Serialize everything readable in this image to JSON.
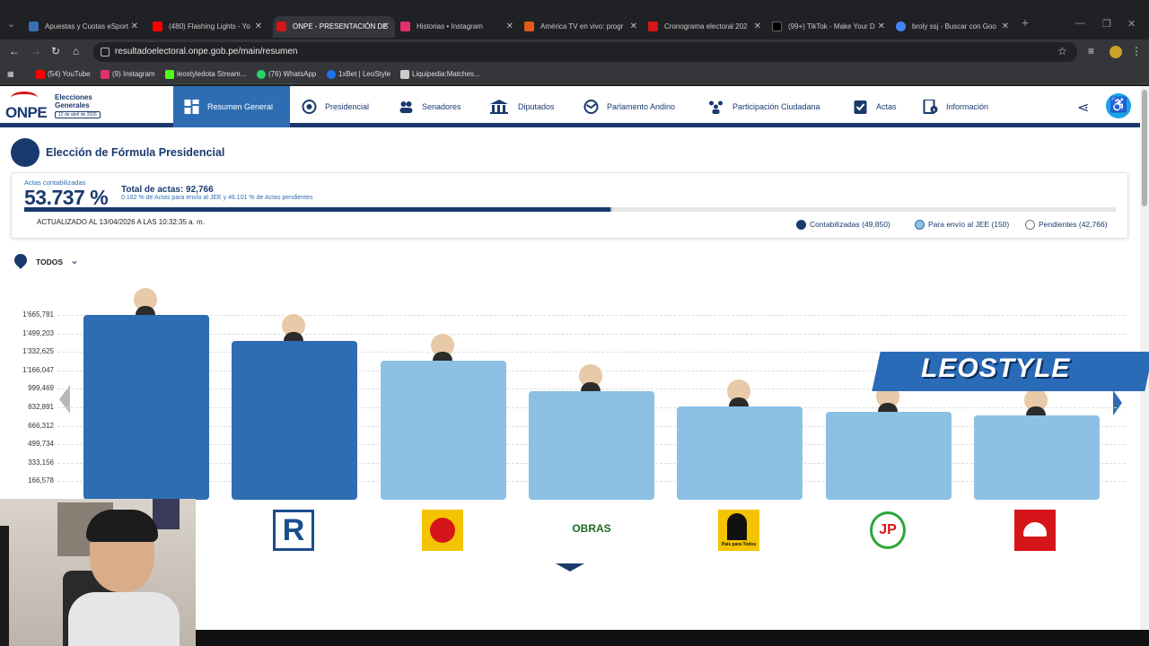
{
  "browser": {
    "tabs": [
      {
        "title": "Apuestas y Cuotas eSport",
        "favicon_color": "#3a6fb0",
        "active": false
      },
      {
        "title": "(480) Flashing Lights - Yo",
        "favicon_color": "#ff0000",
        "active": false
      },
      {
        "title": "ONPE - PRESENTACIÓN DE",
        "favicon_color": "#d6151b",
        "active": true
      },
      {
        "title": "Historias • Instagram",
        "favicon_color": "#e1306c",
        "active": false
      },
      {
        "title": "América TV en vivo: progr",
        "favicon_color": "#e35b1b",
        "active": false
      },
      {
        "title": "Cronograma electoral 202",
        "favicon_color": "#d6151b",
        "active": false
      },
      {
        "title": "(99+) TikTok - Make Your D",
        "favicon_color": "#000000",
        "active": false
      },
      {
        "title": "broly ssj - Buscar con Goo",
        "favicon_color": "#4285f4",
        "active": false
      }
    ],
    "url": "resultadoelectoral.onpe.gob.pe/main/resumen",
    "bookmarks": [
      {
        "label": "(54) YouTube",
        "color": "#ff0000"
      },
      {
        "label": "(9) Instagram",
        "color": "#e1306c"
      },
      {
        "label": "leostyledota Stream...",
        "color": "#53fc18"
      },
      {
        "label": "(76) WhatsApp",
        "color": "#25d366"
      },
      {
        "label": "1xBet | LeoStyle",
        "color": "#1a73e8"
      },
      {
        "label": "Liquipedia:Matches...",
        "color": "#cccccc"
      }
    ]
  },
  "site": {
    "logo": {
      "name": "ONPE",
      "title_line1": "Elecciones",
      "title_line2": "Generales",
      "date": "12 de abril de 2026"
    },
    "nav": [
      {
        "label": "Resumen General",
        "icon": "grid-icon",
        "active": true
      },
      {
        "label": "Presidencial",
        "icon": "shield-icon",
        "active": false
      },
      {
        "label": "Senadores",
        "icon": "people-icon",
        "active": false
      },
      {
        "label": "Diputados",
        "icon": "building-icon",
        "active": false
      },
      {
        "label": "Parlamento Andino",
        "icon": "globe-icon",
        "active": false
      },
      {
        "label": "Participación Ciudadana",
        "icon": "group-icon",
        "active": false
      },
      {
        "label": "Actas",
        "icon": "clipboard-check-icon",
        "active": false
      },
      {
        "label": "Información",
        "icon": "info-doc-icon",
        "active": false
      }
    ],
    "section_title": "Elección de Fórmula Presidencial",
    "summary": {
      "label": "Actas contabilizadas",
      "percent": "53.737 %",
      "percent_value": 53.737,
      "jee_percent_value": 0.162,
      "total": "Total de actas: 92,766",
      "pending_note": "0.162 % de Actas para envío al JEE y 46.101 % de Actas pendientes",
      "updated": "ACTUALIZADO AL 13/04/2026 A LAS 10:32:35 a. m.",
      "legend": [
        {
          "label": "Contabilizadas (49,850)",
          "color": "#1a3a6e"
        },
        {
          "label": "Para envío al JEE (150)",
          "color": "#8cc0e4"
        },
        {
          "label": "Pendientes (42,766)",
          "color": "#ffffff"
        }
      ]
    },
    "filter": {
      "label": "TODOS"
    },
    "colors": {
      "highlight": "#2f6db3",
      "default": "#8cc0e4",
      "brand": "#1a3a6e"
    }
  },
  "chart_data": {
    "type": "bar",
    "ylim": [
      0,
      1665781
    ],
    "yticks": [
      "1'665,781",
      "1'499,203",
      "1'332,625",
      "1'166,047",
      "999,469",
      "832,891",
      "666,312",
      "499,734",
      "333,156",
      "166,578"
    ],
    "ytick_values": [
      1665781,
      1499203,
      1332625,
      1166047,
      999469,
      832891,
      666312,
      499734,
      333156,
      166578
    ],
    "values": [
      1665781,
      1430000,
      1250000,
      980000,
      840000,
      790000,
      760000
    ],
    "highlighted": [
      true,
      true,
      false,
      false,
      false,
      false,
      false
    ],
    "party_logos": [
      "",
      "renovacion-popular-logo",
      "sun-logo",
      "obras-logo",
      "pais-para-todos-logo",
      "juntos-peru-logo",
      "red-helmet-logo"
    ],
    "party_texts": [
      "",
      "R",
      "",
      "OBRAS",
      "País para Todos",
      "JP",
      ""
    ]
  },
  "overlay": {
    "text": "LEOSTYLE"
  }
}
